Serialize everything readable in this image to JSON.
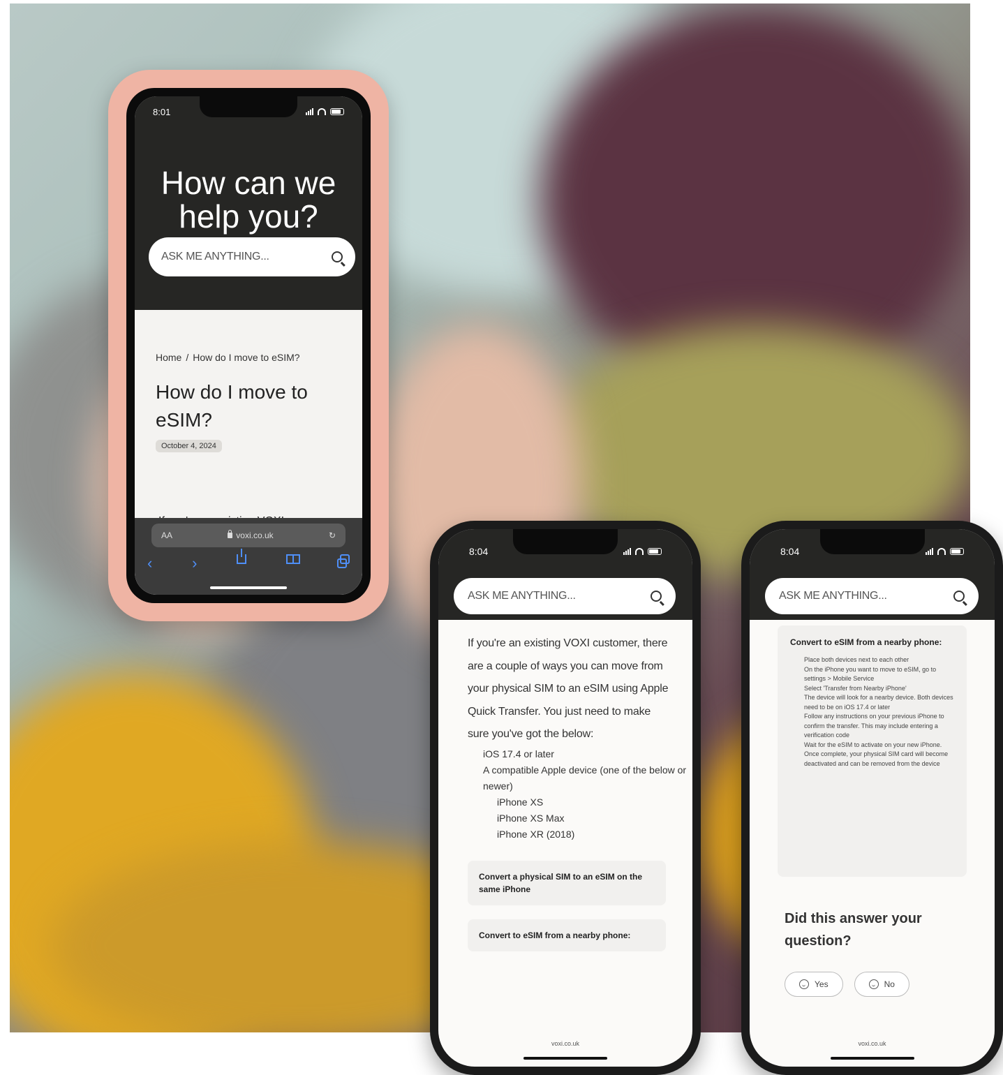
{
  "main_phone": {
    "time": "8:01",
    "hero_title": "How can we help you?",
    "search_placeholder": "ASK ME ANYTHING...",
    "breadcrumb": {
      "home": "Home",
      "separator": "/",
      "current": "How do I move to eSIM?"
    },
    "article_title": "How do I move to eSIM?",
    "date": "October 4, 2024",
    "intro_peek": "If you're an existing VOXI",
    "browser": {
      "text_size": "AA",
      "url": "voxi.co.uk"
    }
  },
  "phone_2": {
    "time": "8:04",
    "search_placeholder": "ASK ME ANYTHING...",
    "intro": "If you're an existing VOXI customer, there are a couple of ways you can move from your physical SIM to an eSIM using Apple Quick Transfer. You just need to make sure you've got the below:",
    "requirements": [
      "iOS 17.4 or later",
      "A compatible Apple device (one of the below or newer)"
    ],
    "devices": [
      "iPhone XS",
      "iPhone XS Max",
      "iPhone XR (2018)"
    ],
    "accordions": [
      "Convert a physical SIM to an eSIM on the same iPhone",
      "Convert to eSIM from a nearby phone:"
    ],
    "url": "voxi.co.uk"
  },
  "phone_3": {
    "time": "8:04",
    "search_placeholder": "ASK ME ANYTHING...",
    "section_title": "Convert to eSIM from a nearby phone:",
    "steps": [
      "Place both devices next to each other",
      "On the iPhone you want to move to eSIM, go to settings > Mobile Service",
      "Select 'Transfer from Nearby iPhone'",
      "The device will look for a nearby device. Both devices need to be on iOS 17.4 or later",
      "Follow any instructions on your previous iPhone to confirm the transfer. This may include entering a verification code",
      "Wait for the eSIM to activate on your new iPhone. Once complete, your physical SIM card will become deactivated and can be removed from the device"
    ],
    "feedback_question": "Did this answer your question?",
    "yes_label": "Yes",
    "no_label": "No",
    "url": "voxi.co.uk"
  }
}
